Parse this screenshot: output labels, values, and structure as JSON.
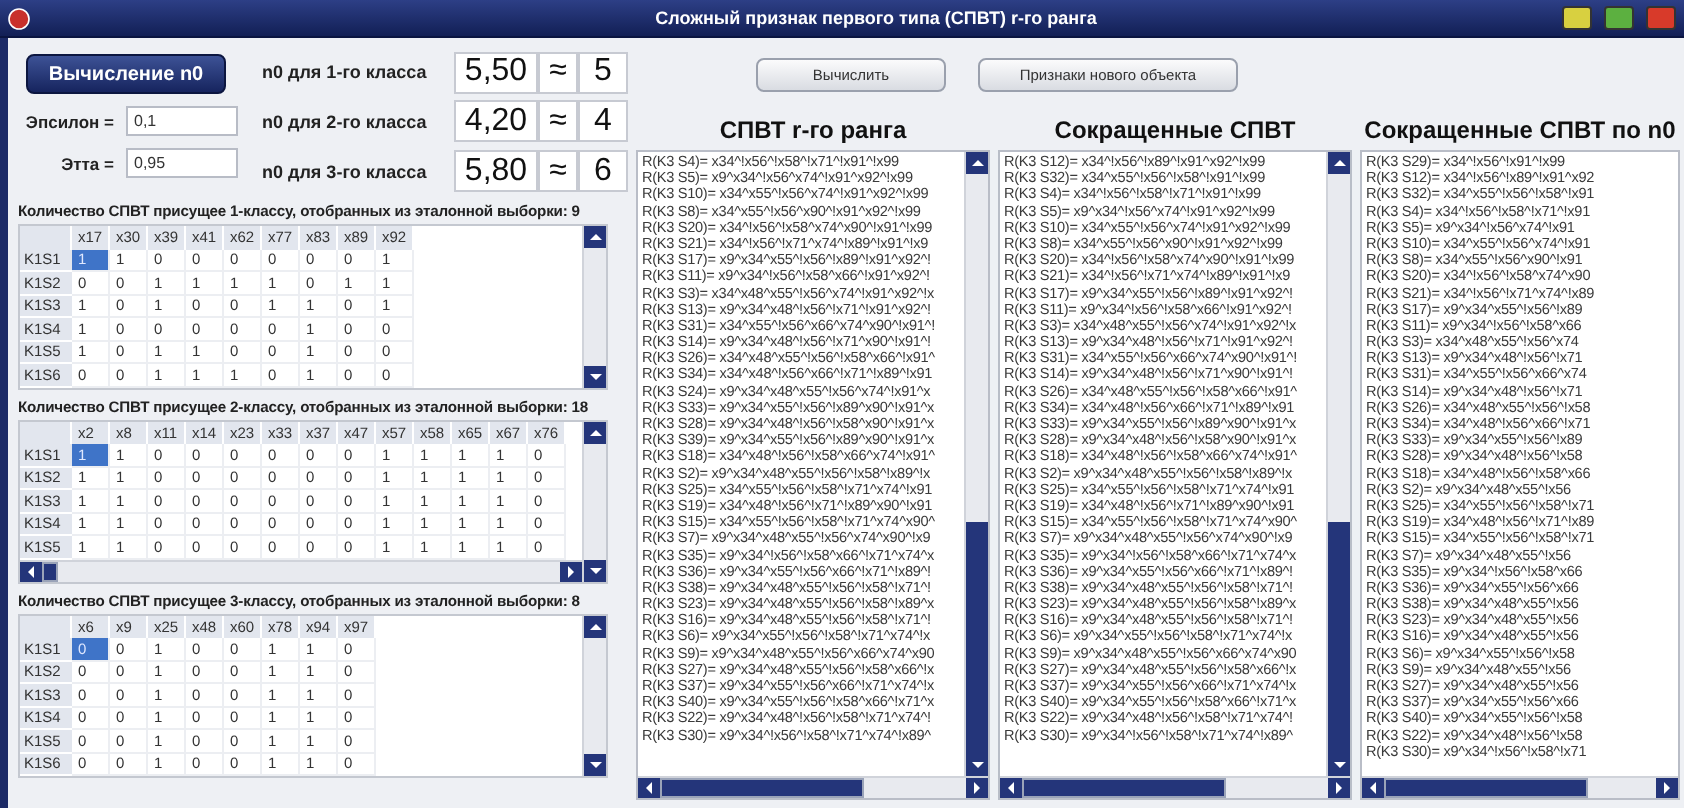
{
  "window": {
    "title": "Сложный признак первого типа (СПВТ) r-го ранга"
  },
  "compute_n0_button": "Вычисление n0",
  "params": [
    {
      "label": "Эпсилон =",
      "value": "0,1"
    },
    {
      "label": "Этта =",
      "value": "0,95"
    }
  ],
  "n0_classes": [
    {
      "label": "n0 для 1-го класса",
      "value": "5,50",
      "approx": "≈",
      "rounded": "5"
    },
    {
      "label": "n0 для 2-го класса",
      "value": "4,20",
      "approx": "≈",
      "rounded": "4"
    },
    {
      "label": "n0 для 3-го класса",
      "value": "5,80",
      "approx": "≈",
      "rounded": "6"
    }
  ],
  "buttons": [
    "Вычислить",
    "Признаки нового объекта"
  ],
  "class_tables": [
    {
      "title": "Количество СПВТ присущее 1-классу, отобранных из эталонной выборки: 9",
      "horizontal_scrollbar": false,
      "columns": [
        "x17",
        "x30",
        "x39",
        "x41",
        "x62",
        "x77",
        "x83",
        "x89",
        "x92"
      ],
      "rows": [
        {
          "label": "K1S1",
          "selected": true,
          "cells": [
            "1",
            "1",
            "0",
            "0",
            "0",
            "0",
            "0",
            "0",
            "1"
          ]
        },
        {
          "label": "K1S2",
          "selected": false,
          "cells": [
            "0",
            "0",
            "1",
            "1",
            "1",
            "1",
            "0",
            "1",
            "1"
          ]
        },
        {
          "label": "K1S3",
          "selected": false,
          "cells": [
            "1",
            "0",
            "1",
            "0",
            "0",
            "1",
            "1",
            "0",
            "1"
          ]
        },
        {
          "label": "K1S4",
          "selected": false,
          "cells": [
            "1",
            "0",
            "0",
            "0",
            "0",
            "0",
            "1",
            "0",
            "0"
          ]
        },
        {
          "label": "K1S5",
          "selected": false,
          "cells": [
            "1",
            "0",
            "1",
            "1",
            "0",
            "0",
            "1",
            "0",
            "0"
          ]
        },
        {
          "label": "K1S6",
          "selected": false,
          "cells": [
            "0",
            "0",
            "1",
            "1",
            "1",
            "0",
            "1",
            "0",
            "0"
          ]
        }
      ]
    },
    {
      "title": "Количество СПВТ присущее 2-классу, отобранных из эталонной выборки: 18",
      "horizontal_scrollbar": true,
      "columns": [
        "x2",
        "x8",
        "x11",
        "x14",
        "x23",
        "x33",
        "x37",
        "x47",
        "x57",
        "x58",
        "x65",
        "x67",
        "x76"
      ],
      "rows": [
        {
          "label": "K1S1",
          "selected": true,
          "cells": [
            "1",
            "1",
            "0",
            "0",
            "0",
            "0",
            "0",
            "0",
            "1",
            "1",
            "1",
            "1",
            "0"
          ]
        },
        {
          "label": "K1S2",
          "selected": false,
          "cells": [
            "1",
            "1",
            "0",
            "0",
            "0",
            "0",
            "0",
            "0",
            "1",
            "1",
            "1",
            "1",
            "0"
          ]
        },
        {
          "label": "K1S3",
          "selected": false,
          "cells": [
            "1",
            "1",
            "0",
            "0",
            "0",
            "0",
            "0",
            "0",
            "1",
            "1",
            "1",
            "1",
            "0"
          ]
        },
        {
          "label": "K1S4",
          "selected": false,
          "cells": [
            "1",
            "1",
            "0",
            "0",
            "0",
            "0",
            "0",
            "0",
            "1",
            "1",
            "1",
            "1",
            "0"
          ]
        },
        {
          "label": "K1S5",
          "selected": false,
          "cells": [
            "1",
            "1",
            "0",
            "0",
            "0",
            "0",
            "0",
            "0",
            "1",
            "1",
            "1",
            "1",
            "0"
          ]
        }
      ]
    },
    {
      "title": "Количество СПВТ присущее 3-классу, отобранных из эталонной выборки: 8",
      "horizontal_scrollbar": false,
      "columns": [
        "x6",
        "x9",
        "x25",
        "x48",
        "x60",
        "x78",
        "x94",
        "x97"
      ],
      "rows": [
        {
          "label": "K1S1",
          "selected": true,
          "cells": [
            "0",
            "0",
            "1",
            "0",
            "0",
            "1",
            "1",
            "0"
          ]
        },
        {
          "label": "K1S2",
          "selected": false,
          "cells": [
            "0",
            "0",
            "1",
            "0",
            "0",
            "1",
            "1",
            "0"
          ]
        },
        {
          "label": "K1S3",
          "selected": false,
          "cells": [
            "0",
            "0",
            "1",
            "0",
            "0",
            "1",
            "1",
            "0"
          ]
        },
        {
          "label": "K1S4",
          "selected": false,
          "cells": [
            "0",
            "0",
            "1",
            "0",
            "0",
            "1",
            "1",
            "0"
          ]
        },
        {
          "label": "K1S5",
          "selected": false,
          "cells": [
            "0",
            "0",
            "1",
            "0",
            "0",
            "1",
            "1",
            "0"
          ]
        },
        {
          "label": "K1S6",
          "selected": false,
          "cells": [
            "0",
            "0",
            "1",
            "0",
            "0",
            "1",
            "1",
            "0"
          ]
        }
      ]
    }
  ],
  "lists": [
    {
      "title": "СПВТ r-го ранга",
      "vertical_scrollbar": true,
      "items": [
        "R(K3 S4)= x34^!x56^!x58^!x71^!x91^!x99",
        "R(K3 S5)= x9^x34^!x56^x74^!x91^x92^!x99",
        "R(K3 S10)= x34^x55^!x56^x74^!x91^x92^!x99",
        "R(K3 S8)= x34^x55^!x56^x90^!x91^x92^!x99",
        "R(K3 S20)= x34^!x56^!x58^x74^x90^!x91^!x99",
        "R(K3 S21)= x34^!x56^!x71^x74^!x89^!x91^!x9",
        "R(K3 S17)= x9^x34^x55^!x56^!x89^!x91^x92^!",
        "R(K3 S11)= x9^x34^!x56^!x58^x66^!x91^x92^!",
        "R(K3 S3)= x34^x48^x55^!x56^x74^!x91^x92^!x",
        "R(K3 S13)= x9^x34^x48^!x56^!x71^!x91^x92^!",
        "R(K3 S31)= x34^x55^!x56^x66^x74^x90^!x91^!",
        "R(K3 S14)= x9^x34^x48^!x56^!x71^x90^!x91^!",
        "R(K3 S26)= x34^x48^x55^!x56^!x58^x66^!x91^",
        "R(K3 S34)= x34^x48^!x56^x66^!x71^!x89^!x91",
        "R(K3 S24)= x9^x34^x48^x55^!x56^x74^!x91^x",
        "R(K3 S33)= x9^x34^x55^!x56^!x89^x90^!x91^x",
        "R(K3 S28)= x9^x34^x48^!x56^!x58^x90^!x91^x",
        "R(K3 S39)= x9^x34^x55^!x56^!x89^x90^!x91^x",
        "R(K3 S18)= x34^x48^!x56^!x58^x66^x74^!x91^",
        "R(K3 S2)= x9^x34^x48^x55^!x56^!x58^!x89^!x",
        "R(K3 S25)= x34^x55^!x56^!x58^!x71^x74^!x91",
        "R(K3 S19)= x34^x48^!x56^!x71^!x89^x90^!x91",
        "R(K3 S15)= x34^x55^!x56^!x58^!x71^x74^x90^",
        "R(K3 S7)= x9^x34^x48^x55^!x56^x74^x90^!x9",
        "R(K3 S35)= x9^x34^!x56^!x58^x66^!x71^x74^x",
        "R(K3 S36)= x9^x34^x55^!x56^x66^!x71^!x89^!",
        "R(K3 S38)= x9^x34^x48^x55^!x56^!x58^!x71^!",
        "R(K3 S23)= x9^x34^x48^x55^!x56^!x58^!x89^x",
        "R(K3 S16)= x9^x34^x48^x55^!x56^!x58^!x71^!",
        "R(K3 S6)= x9^x34^x55^!x56^!x58^!x71^x74^!x",
        "R(K3 S9)= x9^x34^x48^x55^!x56^x66^x74^x90",
        "R(K3 S27)= x9^x34^x48^x55^!x56^!x58^x66^!x",
        "R(K3 S37)= x9^x34^x55^!x56^x66^!x71^x74^!x",
        "R(K3 S40)= x9^x34^x55^!x56^!x58^x66^!x71^x",
        "R(K3 S22)= x9^x34^x48^!x56^!x58^!x71^x74^!",
        "R(K3 S30)= x9^x34^!x56^!x58^!x71^x74^!x89^"
      ]
    },
    {
      "title": "Сокращенные СПВТ",
      "vertical_scrollbar": true,
      "items": [
        "R(K3 S12)= x34^!x56^!x89^!x91^x92^!x99",
        "R(K3 S32)= x34^x55^!x56^!x58^!x91^!x99",
        "R(K3 S4)= x34^!x56^!x58^!x71^!x91^!x99",
        "R(K3 S5)= x9^x34^!x56^x74^!x91^x92^!x99",
        "R(K3 S10)= x34^x55^!x56^x74^!x91^x92^!x99",
        "R(K3 S8)= x34^x55^!x56^x90^!x91^x92^!x99",
        "R(K3 S20)= x34^!x56^!x58^x74^x90^!x91^!x99",
        "R(K3 S21)= x34^!x56^!x71^x74^!x89^!x91^!x9",
        "R(K3 S17)= x9^x34^x55^!x56^!x89^!x91^x92^!",
        "R(K3 S11)= x9^x34^!x56^!x58^x66^!x91^x92^!",
        "R(K3 S3)= x34^x48^x55^!x56^x74^!x91^x92^!x",
        "R(K3 S13)= x9^x34^x48^!x56^!x71^!x91^x92^!",
        "R(K3 S31)= x34^x55^!x56^x66^x74^x90^!x91^!",
        "R(K3 S14)= x9^x34^x48^!x56^!x71^x90^!x91^!",
        "R(K3 S26)= x34^x48^x55^!x56^!x58^x66^!x91^",
        "R(K3 S34)= x34^x48^!x56^x66^!x71^!x89^!x91",
        "R(K3 S33)= x9^x34^x55^!x56^!x89^x90^!x91^x",
        "R(K3 S28)= x9^x34^x48^!x56^!x58^x90^!x91^x",
        "R(K3 S18)= x34^x48^!x56^!x58^x66^x74^!x91^",
        "R(K3 S2)= x9^x34^x48^x55^!x56^!x58^!x89^!x",
        "R(K3 S25)= x34^x55^!x56^!x58^!x71^x74^!x91",
        "R(K3 S19)= x34^x48^!x56^!x71^!x89^x90^!x91",
        "R(K3 S15)= x34^x55^!x56^!x58^!x71^x74^x90^",
        "R(K3 S7)= x9^x34^x48^x55^!x56^x74^x90^!x9",
        "R(K3 S35)= x9^x34^!x56^!x58^x66^!x71^x74^x",
        "R(K3 S36)= x9^x34^x55^!x56^x66^!x71^!x89^!",
        "R(K3 S38)= x9^x34^x48^x55^!x56^!x58^!x71^!",
        "R(K3 S23)= x9^x34^x48^x55^!x56^!x58^!x89^x",
        "R(K3 S16)= x9^x34^x48^x55^!x56^!x58^!x71^!",
        "R(K3 S6)= x9^x34^x55^!x56^!x58^!x71^x74^!x",
        "R(K3 S9)= x9^x34^x48^x55^!x56^x66^x74^x90",
        "R(K3 S27)= x9^x34^x48^x55^!x56^!x58^x66^!x",
        "R(K3 S37)= x9^x34^x55^!x56^x66^!x71^x74^!x",
        "R(K3 S40)= x9^x34^x55^!x56^!x58^x66^!x71^x",
        "R(K3 S22)= x9^x34^x48^!x56^!x58^!x71^x74^!",
        "R(K3 S30)= x9^x34^!x56^!x58^!x71^x74^!x89^"
      ]
    },
    {
      "title": "Сокращенные СПВТ по n0",
      "vertical_scrollbar": false,
      "items": [
        "R(K3 S29)= x34^!x56^!x91^!x99",
        "R(K3 S12)= x34^!x56^!x89^!x91^x92",
        "R(K3 S32)= x34^x55^!x56^!x58^!x91",
        "R(K3 S4)= x34^!x56^!x58^!x71^!x91",
        "R(K3 S5)= x9^x34^!x56^x74^!x91",
        "R(K3 S10)= x34^x55^!x56^x74^!x91",
        "R(K3 S8)= x34^x55^!x56^x90^!x91",
        "R(K3 S20)= x34^!x56^!x58^x74^x90",
        "R(K3 S21)= x34^!x56^!x71^x74^!x89",
        "R(K3 S17)= x9^x34^x55^!x56^!x89",
        "R(K3 S11)= x9^x34^!x56^!x58^x66",
        "R(K3 S3)= x34^x48^x55^!x56^x74",
        "R(K3 S13)= x9^x34^x48^!x56^!x71",
        "R(K3 S31)= x34^x55^!x56^x66^x74",
        "R(K3 S14)= x9^x34^x48^!x56^!x71",
        "R(K3 S26)= x34^x48^x55^!x56^!x58",
        "R(K3 S34)= x34^x48^!x56^x66^!x71",
        "R(K3 S33)= x9^x34^x55^!x56^!x89",
        "R(K3 S28)= x9^x34^x48^!x56^!x58",
        "R(K3 S18)= x34^x48^!x56^!x58^x66",
        "R(K3 S2)= x9^x34^x48^x55^!x56",
        "R(K3 S25)= x34^x55^!x56^!x58^!x71",
        "R(K3 S19)= x34^x48^!x56^!x71^!x89",
        "R(K3 S15)= x34^x55^!x56^!x58^!x71",
        "R(K3 S7)= x9^x34^x48^x55^!x56",
        "R(K3 S35)= x9^x34^!x56^!x58^x66",
        "R(K3 S36)= x9^x34^x55^!x56^x66",
        "R(K3 S38)= x9^x34^x48^x55^!x56",
        "R(K3 S23)= x9^x34^x48^x55^!x56",
        "R(K3 S16)= x9^x34^x48^x55^!x56",
        "R(K3 S6)= x9^x34^x55^!x56^!x58",
        "R(K3 S9)= x9^x34^x48^x55^!x56",
        "R(K3 S27)= x9^x34^x48^x55^!x56",
        "R(K3 S37)= x9^x34^x55^!x56^x66",
        "R(K3 S40)= x9^x34^x55^!x56^!x58",
        "R(K3 S22)= x9^x34^x48^!x56^!x58",
        "R(K3 S30)= x9^x34^!x56^!x58^!x71"
      ]
    }
  ]
}
